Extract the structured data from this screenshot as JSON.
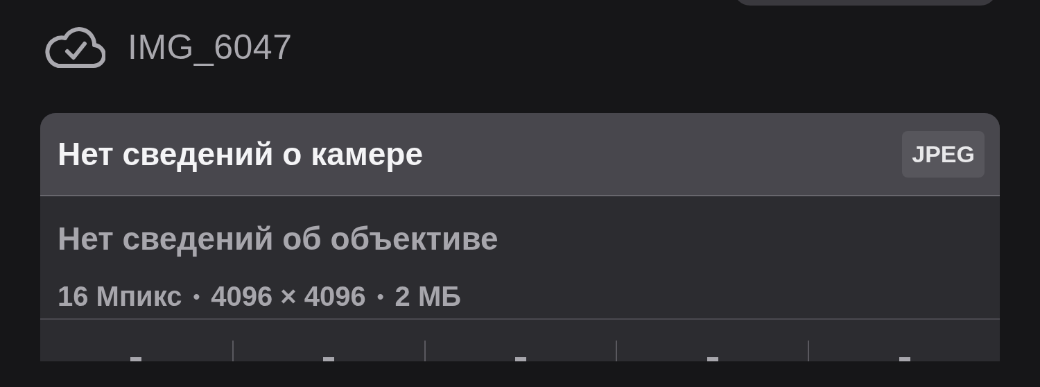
{
  "file": {
    "name": "IMG_6047",
    "synced": true
  },
  "card": {
    "camera": "Нет сведений о камере",
    "format": "JPEG",
    "lens": "Нет сведений об объективе",
    "details": [
      "16 Мпикс",
      "4096 × 4096",
      "2 МБ"
    ],
    "separator": "•"
  }
}
